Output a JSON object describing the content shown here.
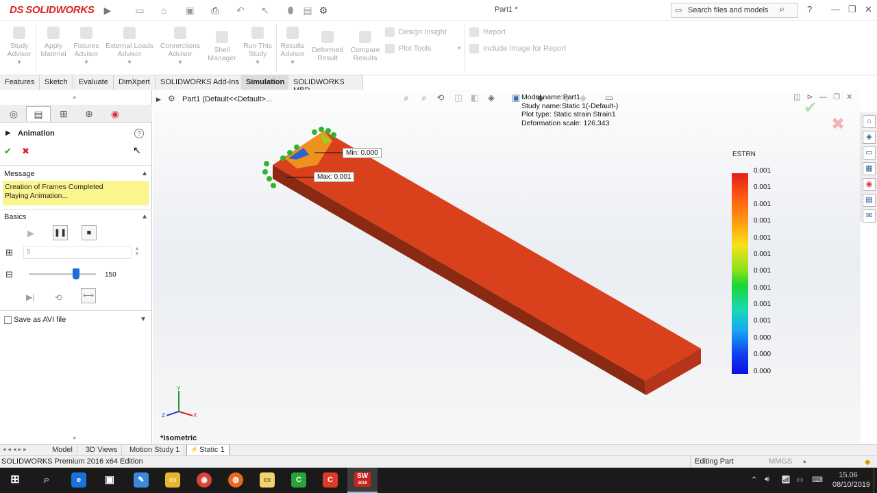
{
  "app": {
    "logo_prefix": "DS",
    "logo_text": "SOLIDWORKS",
    "document_title": "Part1 *",
    "search_placeholder": "Search files and models",
    "help_label": "?"
  },
  "ribbon": {
    "buttons": [
      {
        "label_1": "Study",
        "label_2": "Advisor"
      },
      {
        "label_1": "Apply",
        "label_2": "Material"
      },
      {
        "label_1": "Fixtures",
        "label_2": "Advisor"
      },
      {
        "label_1": "External Loads",
        "label_2": "Advisor"
      },
      {
        "label_1": "Connections",
        "label_2": "Advisor"
      },
      {
        "label_1": "Shell",
        "label_2": "Manager"
      },
      {
        "label_1": "Run This",
        "label_2": "Study"
      },
      {
        "label_1": "Results",
        "label_2": "Advisor"
      },
      {
        "label_1": "Deformed",
        "label_2": "Result"
      },
      {
        "label_1": "Compare",
        "label_2": "Results"
      }
    ],
    "design_insight": "Design Insight",
    "plot_tools": "Plot Tools",
    "report": "Report",
    "include_image": "Include Image for Report"
  },
  "tabs": [
    "Features",
    "Sketch",
    "Evaluate",
    "DimXpert",
    "SOLIDWORKS Add-Ins",
    "Simulation",
    "SOLIDWORKS MBD"
  ],
  "active_tab": "Simulation",
  "panel": {
    "title": "Animation",
    "message_header": "Message",
    "message_line1": "Creation of Frames Completed",
    "message_line2": "Playing Animation...",
    "basics_header": "Basics",
    "frames_value": "5",
    "speed_value": "150",
    "speed_fraction": 0.7,
    "save_avi": "Save as AVI file"
  },
  "viewport": {
    "tree_item": "Part1  (Default<<Default>...",
    "model_name": "Model name:Part1",
    "study_name": "Study name:Static 1(-Default-)",
    "plot_type": "Plot type: Static strain Strain1",
    "deformation": "Deformation scale: 126.343",
    "min_label": "Min: 0.000",
    "max_label": "Max: 0.001",
    "view_label": "*Isometric",
    "legend_title": "ESTRN",
    "legend_values": [
      "0.001",
      "0.001",
      "0.001",
      "0.001",
      "0.001",
      "0.001",
      "0.001",
      "0.001",
      "0.001",
      "0.001",
      "0.000",
      "0.000",
      "0.000"
    ],
    "axis_x": "X",
    "axis_y": "Y",
    "axis_z": "Z"
  },
  "bottom_tabs": [
    "Model",
    "3D Views",
    "Motion Study 1",
    "Static 1"
  ],
  "status": {
    "edition": "SOLIDWORKS Premium 2016 x64 Edition",
    "editing": "Editing Part",
    "units": "MMGS"
  },
  "taskbar": {
    "time": "15.06",
    "date": "08/10/2019",
    "sw_badge": "SW",
    "sw_year": "2016"
  },
  "colors": {
    "accent": "#d22222",
    "model_red": "#d83a18",
    "fixture_green": "#2fb42f",
    "message_bg": "#fbf58e"
  }
}
